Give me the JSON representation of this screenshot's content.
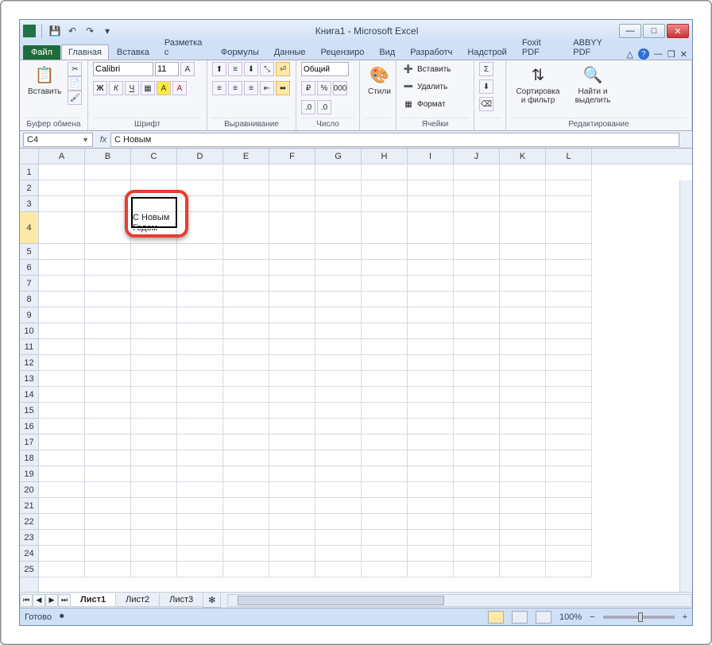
{
  "title": "Книга1  -  Microsoft Excel",
  "tabs": {
    "file": "Файл",
    "items": [
      "Главная",
      "Вставка",
      "Разметка с",
      "Формулы",
      "Данные",
      "Рецензиро",
      "Вид",
      "Разработч",
      "Надстрой",
      "Foxit PDF",
      "ABBYY PDF"
    ],
    "active": "Главная"
  },
  "ribbon": {
    "clipboard": {
      "paste": "Вставить",
      "label": "Буфер обмена"
    },
    "font": {
      "name": "Calibri",
      "size": "11",
      "bold": "Ж",
      "italic": "К",
      "underline": "Ч",
      "label": "Шрифт"
    },
    "align": {
      "label": "Выравнивание"
    },
    "number": {
      "format": "Общий",
      "label": "Число"
    },
    "styles": {
      "btn": "Стили"
    },
    "cells": {
      "insert": "Вставить",
      "delete": "Удалить",
      "format": "Формат",
      "label": "Ячейки"
    },
    "editing": {
      "sort": "Сортировка и фильтр",
      "find": "Найти и выделить",
      "label": "Редактирование"
    }
  },
  "formulaBar": {
    "nameBox": "C4",
    "fx": "fx",
    "value": "С Новым"
  },
  "grid": {
    "cols": [
      "A",
      "B",
      "C",
      "D",
      "E",
      "F",
      "G",
      "H",
      "I",
      "J",
      "K",
      "L"
    ],
    "rows": [
      "1",
      "2",
      "3",
      "4",
      "5",
      "6",
      "7",
      "8",
      "9",
      "10",
      "11",
      "12",
      "13",
      "14",
      "15",
      "16",
      "17",
      "18",
      "19",
      "20",
      "21",
      "22",
      "23",
      "24",
      "25"
    ],
    "selectedRow": "4",
    "cellC3": "С Новым",
    "cellC4": "Годом"
  },
  "sheetTabs": {
    "items": [
      "Лист1",
      "Лист2",
      "Лист3"
    ],
    "active": "Лист1"
  },
  "status": {
    "ready": "Готово",
    "zoom": "100%"
  }
}
